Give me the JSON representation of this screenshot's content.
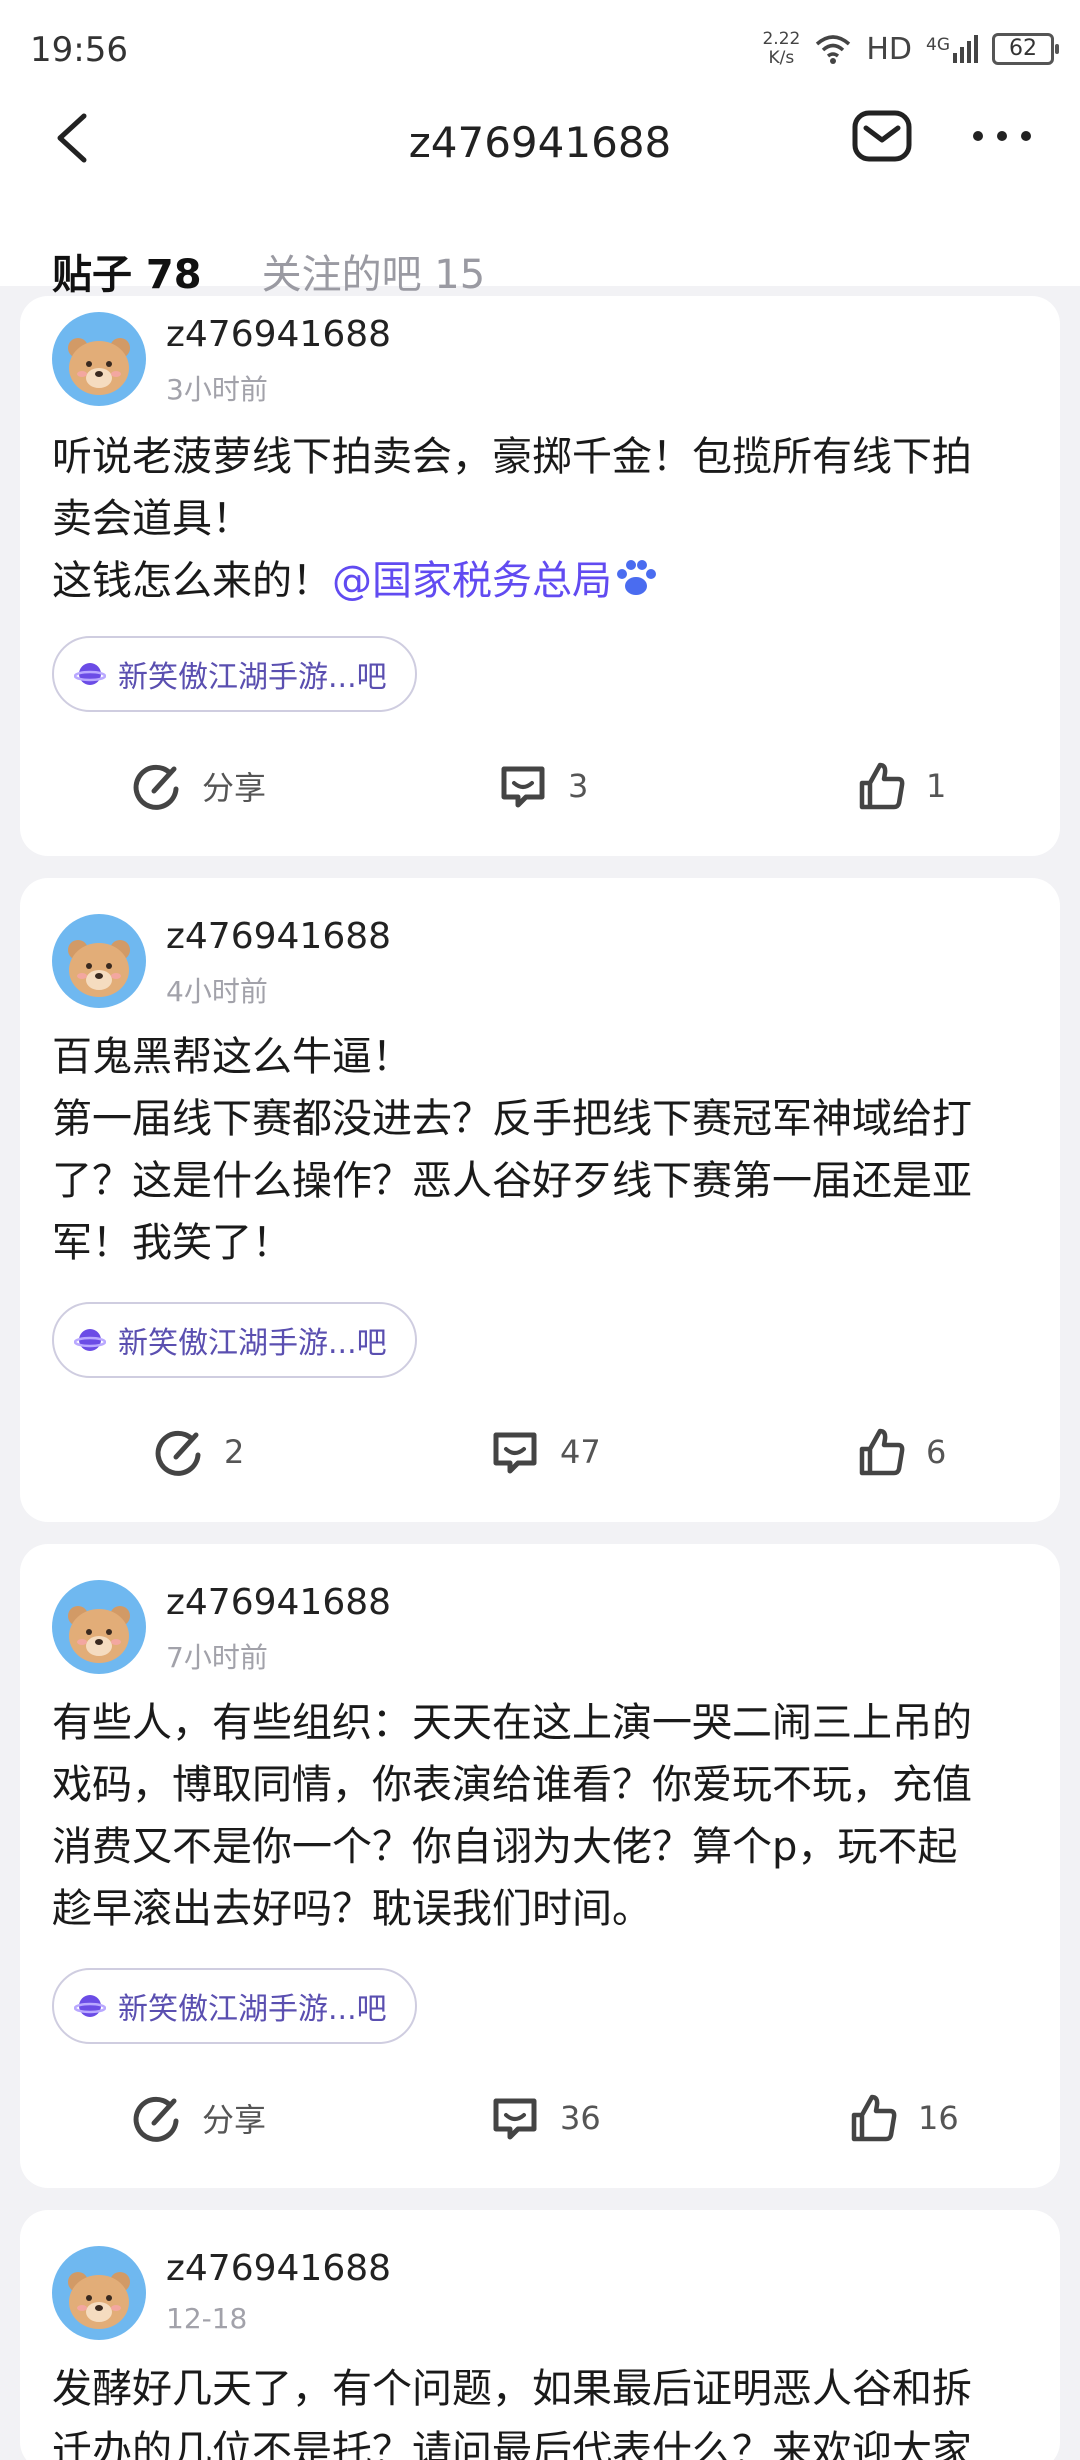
{
  "status": {
    "time": "19:56",
    "speed_value": "2.22",
    "speed_unit": "K/s",
    "network": "HD",
    "signal": "4G",
    "battery": "62"
  },
  "header": {
    "title": "z476941688"
  },
  "tabs": [
    {
      "label": "贴子 78",
      "active": true
    },
    {
      "label": "关注的吧 15",
      "active": false
    }
  ],
  "posts": [
    {
      "username": "z476941688",
      "time": "3小时前",
      "lines": [
        "听说老菠萝线下拍卖会，豪掷千金！包揽所有线下拍",
        "卖会道具！",
        "这钱怎么来的！"
      ],
      "mention": "@国家税务总局",
      "forum": "新笑傲江湖手游...吧",
      "share": "分享",
      "comments": "3",
      "likes": "1"
    },
    {
      "username": "z476941688",
      "time": "4小时前",
      "lines": [
        "百鬼黑帮这么牛逼！",
        "第一届线下赛都没进去？反手把线下赛冠军神域给打",
        "了？这是什么操作？恶人谷好歹线下赛第一届还是亚",
        "军！我笑了！"
      ],
      "forum": "新笑傲江湖手游...吧",
      "share": "2",
      "comments": "47",
      "likes": "6"
    },
    {
      "username": "z476941688",
      "time": "7小时前",
      "lines": [
        "有些人，有些组织：天天在这上演一哭二闹三上吊的",
        "戏码，博取同情，你表演给谁看？你爱玩不玩，充值",
        "消费又不是你一个？你自诩为大佬？算个p，玩不起",
        "趁早滚出去好吗？耽误我们时间。"
      ],
      "forum": "新笑傲江湖手游...吧",
      "share": "分享",
      "comments": "36",
      "likes": "16"
    },
    {
      "username": "z476941688",
      "time": "12-18",
      "lines": [
        "发酵好几天了，有个问题，如果最后证明恶人谷和拆",
        "迁办的几位不是托？请问最后代表什么？来欢迎大家"
      ]
    }
  ],
  "colors": {
    "accent": "#614bf1",
    "background": "#f2f2f5"
  }
}
